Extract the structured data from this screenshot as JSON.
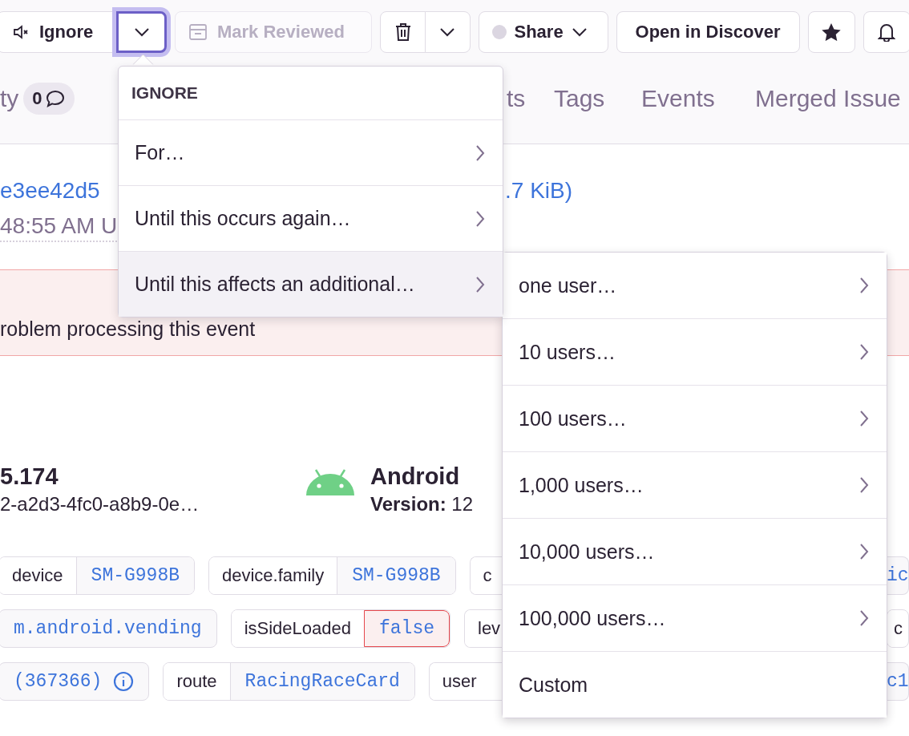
{
  "toolbar": [
    {
      "kind": "ignore",
      "label": "Ignore",
      "disabled": false,
      "expanded": false
    },
    {
      "kind": "dropdown",
      "disabled": false,
      "expanded": true
    },
    {
      "kind": "mark",
      "label": "Mark Reviewed",
      "disabled": true,
      "expanded": false
    },
    {
      "kind": "delete",
      "disabled": false,
      "expanded": false
    },
    {
      "kind": "share",
      "label": "Share",
      "disabled": false,
      "expanded": false
    },
    {
      "kind": "text",
      "label": "Open in Discover",
      "disabled": false,
      "expanded": false
    },
    {
      "kind": "star",
      "disabled": false,
      "expanded": false
    },
    {
      "kind": "bell",
      "disabled": false,
      "expanded": false
    }
  ],
  "tabs": [
    {
      "label": "ty",
      "count": "0"
    },
    {
      "label": "ts"
    },
    {
      "label": "Tags"
    },
    {
      "label": "Events"
    },
    {
      "label": "Merged Issue"
    }
  ],
  "event": {
    "id": "e3ee42d5",
    "size": ".7 KiB)",
    "time": "48:55 AM U"
  },
  "alert": {
    "text": "roblem processing this event"
  },
  "context": [
    {
      "kind": "plain",
      "title": "5.174",
      "subtitle": "2-a2d3-4fc0-a8b9-0e…"
    },
    {
      "kind": "android",
      "title": "Android",
      "subtitle": "**Version:** 12"
    }
  ],
  "tag_rows": [
    [
      {
        "kind": "tag",
        "key": "device",
        "value": "SM-G998B",
        "error": false
      },
      {
        "kind": "tag",
        "key": "device.family",
        "value": "SM-G998B",
        "error": false
      },
      {
        "kind": "cut",
        "key": "c",
        "value": "ic",
        "error": false
      }
    ],
    [
      {
        "kind": "tag",
        "value": "m.android.vending",
        "error": false
      },
      {
        "kind": "tag",
        "key": "isSideLoaded",
        "value": "false",
        "error": true
      },
      {
        "kind": "cut",
        "key": "lev",
        "error": false
      },
      {
        "kind": "tag",
        "key": "c",
        "error": false
      }
    ],
    [
      {
        "kind": "info",
        "value": "(367366)",
        "error": false
      },
      {
        "kind": "tag",
        "key": "route",
        "value": "RacingRaceCard",
        "error": false
      },
      {
        "kind": "cut",
        "key": "user",
        "value": "c1",
        "error": false
      }
    ]
  ],
  "menu": {
    "title": "IGNORE",
    "items": [
      {
        "label": "For…",
        "kind": "submenu",
        "selected": false
      },
      {
        "label": "Until this occurs again…",
        "kind": "submenu",
        "selected": false
      },
      {
        "label": "Until this affects an additional…",
        "kind": "submenu",
        "selected": true
      }
    ]
  },
  "submenu": {
    "items": [
      {
        "label": "one user…",
        "kind": "submenu",
        "selected": false
      },
      {
        "label": "10 users…",
        "kind": "submenu",
        "selected": false
      },
      {
        "label": "100 users…",
        "kind": "submenu",
        "selected": false
      },
      {
        "label": "1,000 users…",
        "kind": "submenu",
        "selected": false
      },
      {
        "label": "10,000 users…",
        "kind": "submenu",
        "selected": false
      },
      {
        "label": "100,000 users…",
        "kind": "submenu",
        "selected": false
      },
      {
        "label": "Custom",
        "kind": "action",
        "selected": false
      }
    ]
  }
}
